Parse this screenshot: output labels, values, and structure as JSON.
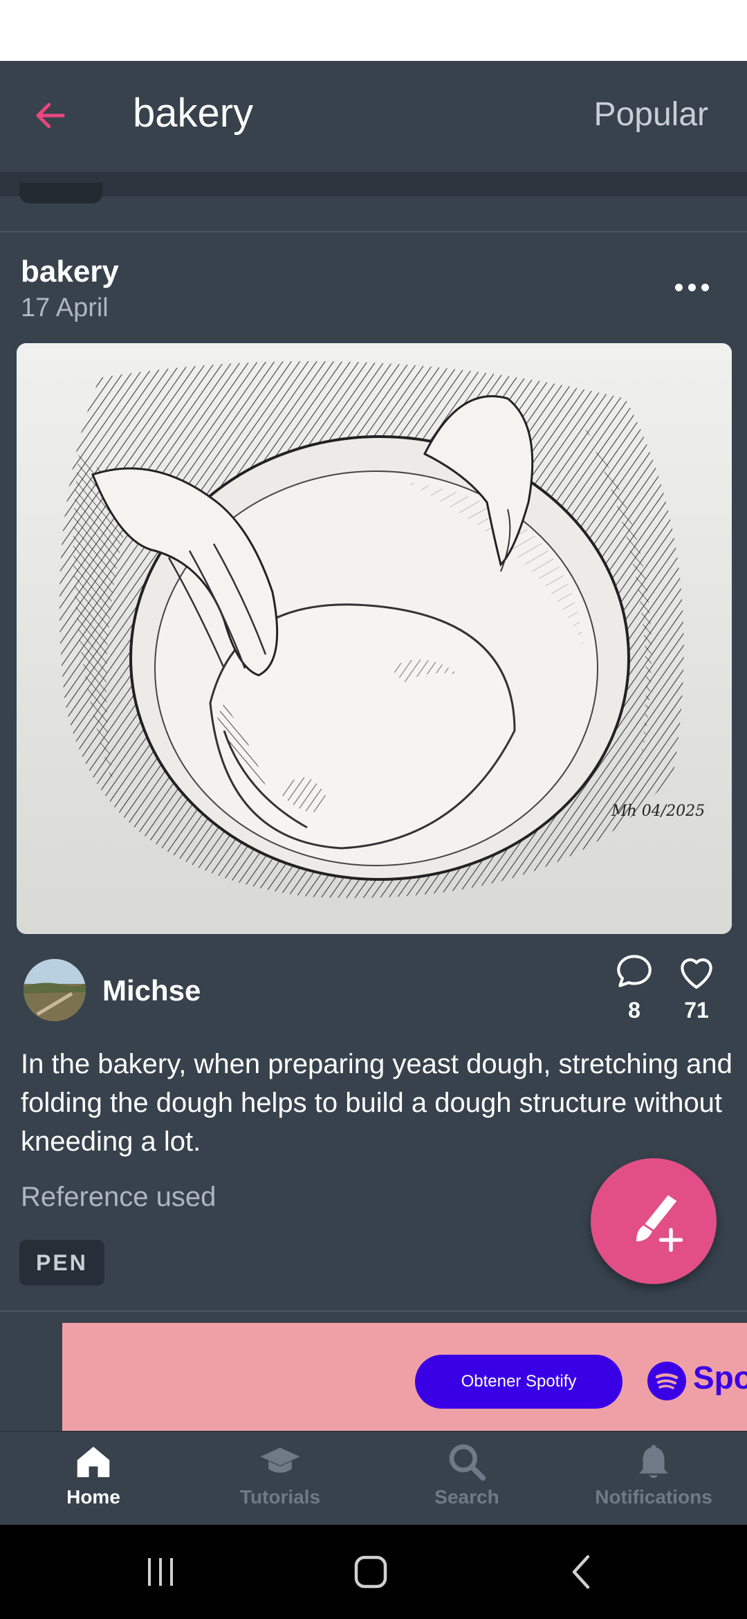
{
  "header": {
    "title": "bakery",
    "sort_label": "Popular"
  },
  "post": {
    "title": "bakery",
    "date": "17 April",
    "author": "Michse",
    "comments": "8",
    "likes": "71",
    "description": "In the bakery, when preparing yeast dough, stretching and folding the dough helps to build a dough structure without kneeding a lot.",
    "reference": "Reference used",
    "tag": "PEN",
    "artwork_signature": "Mh 04/2025"
  },
  "ad": {
    "button_label": "Obtener Spotify",
    "brand": "Spot"
  },
  "nav": {
    "items": [
      {
        "label": "Home",
        "icon": "home-icon",
        "active": true
      },
      {
        "label": "Tutorials",
        "icon": "graduation-cap-icon",
        "active": false
      },
      {
        "label": "Search",
        "icon": "search-icon",
        "active": false
      },
      {
        "label": "Notifications",
        "icon": "bell-icon",
        "active": false
      }
    ]
  },
  "colors": {
    "accent": "#e8467c",
    "background": "#37424d",
    "fab": "#e24f86",
    "ad_background": "#efa0a6",
    "ad_brand": "#3a00e5",
    "inactive_nav": "#6f7a86"
  }
}
